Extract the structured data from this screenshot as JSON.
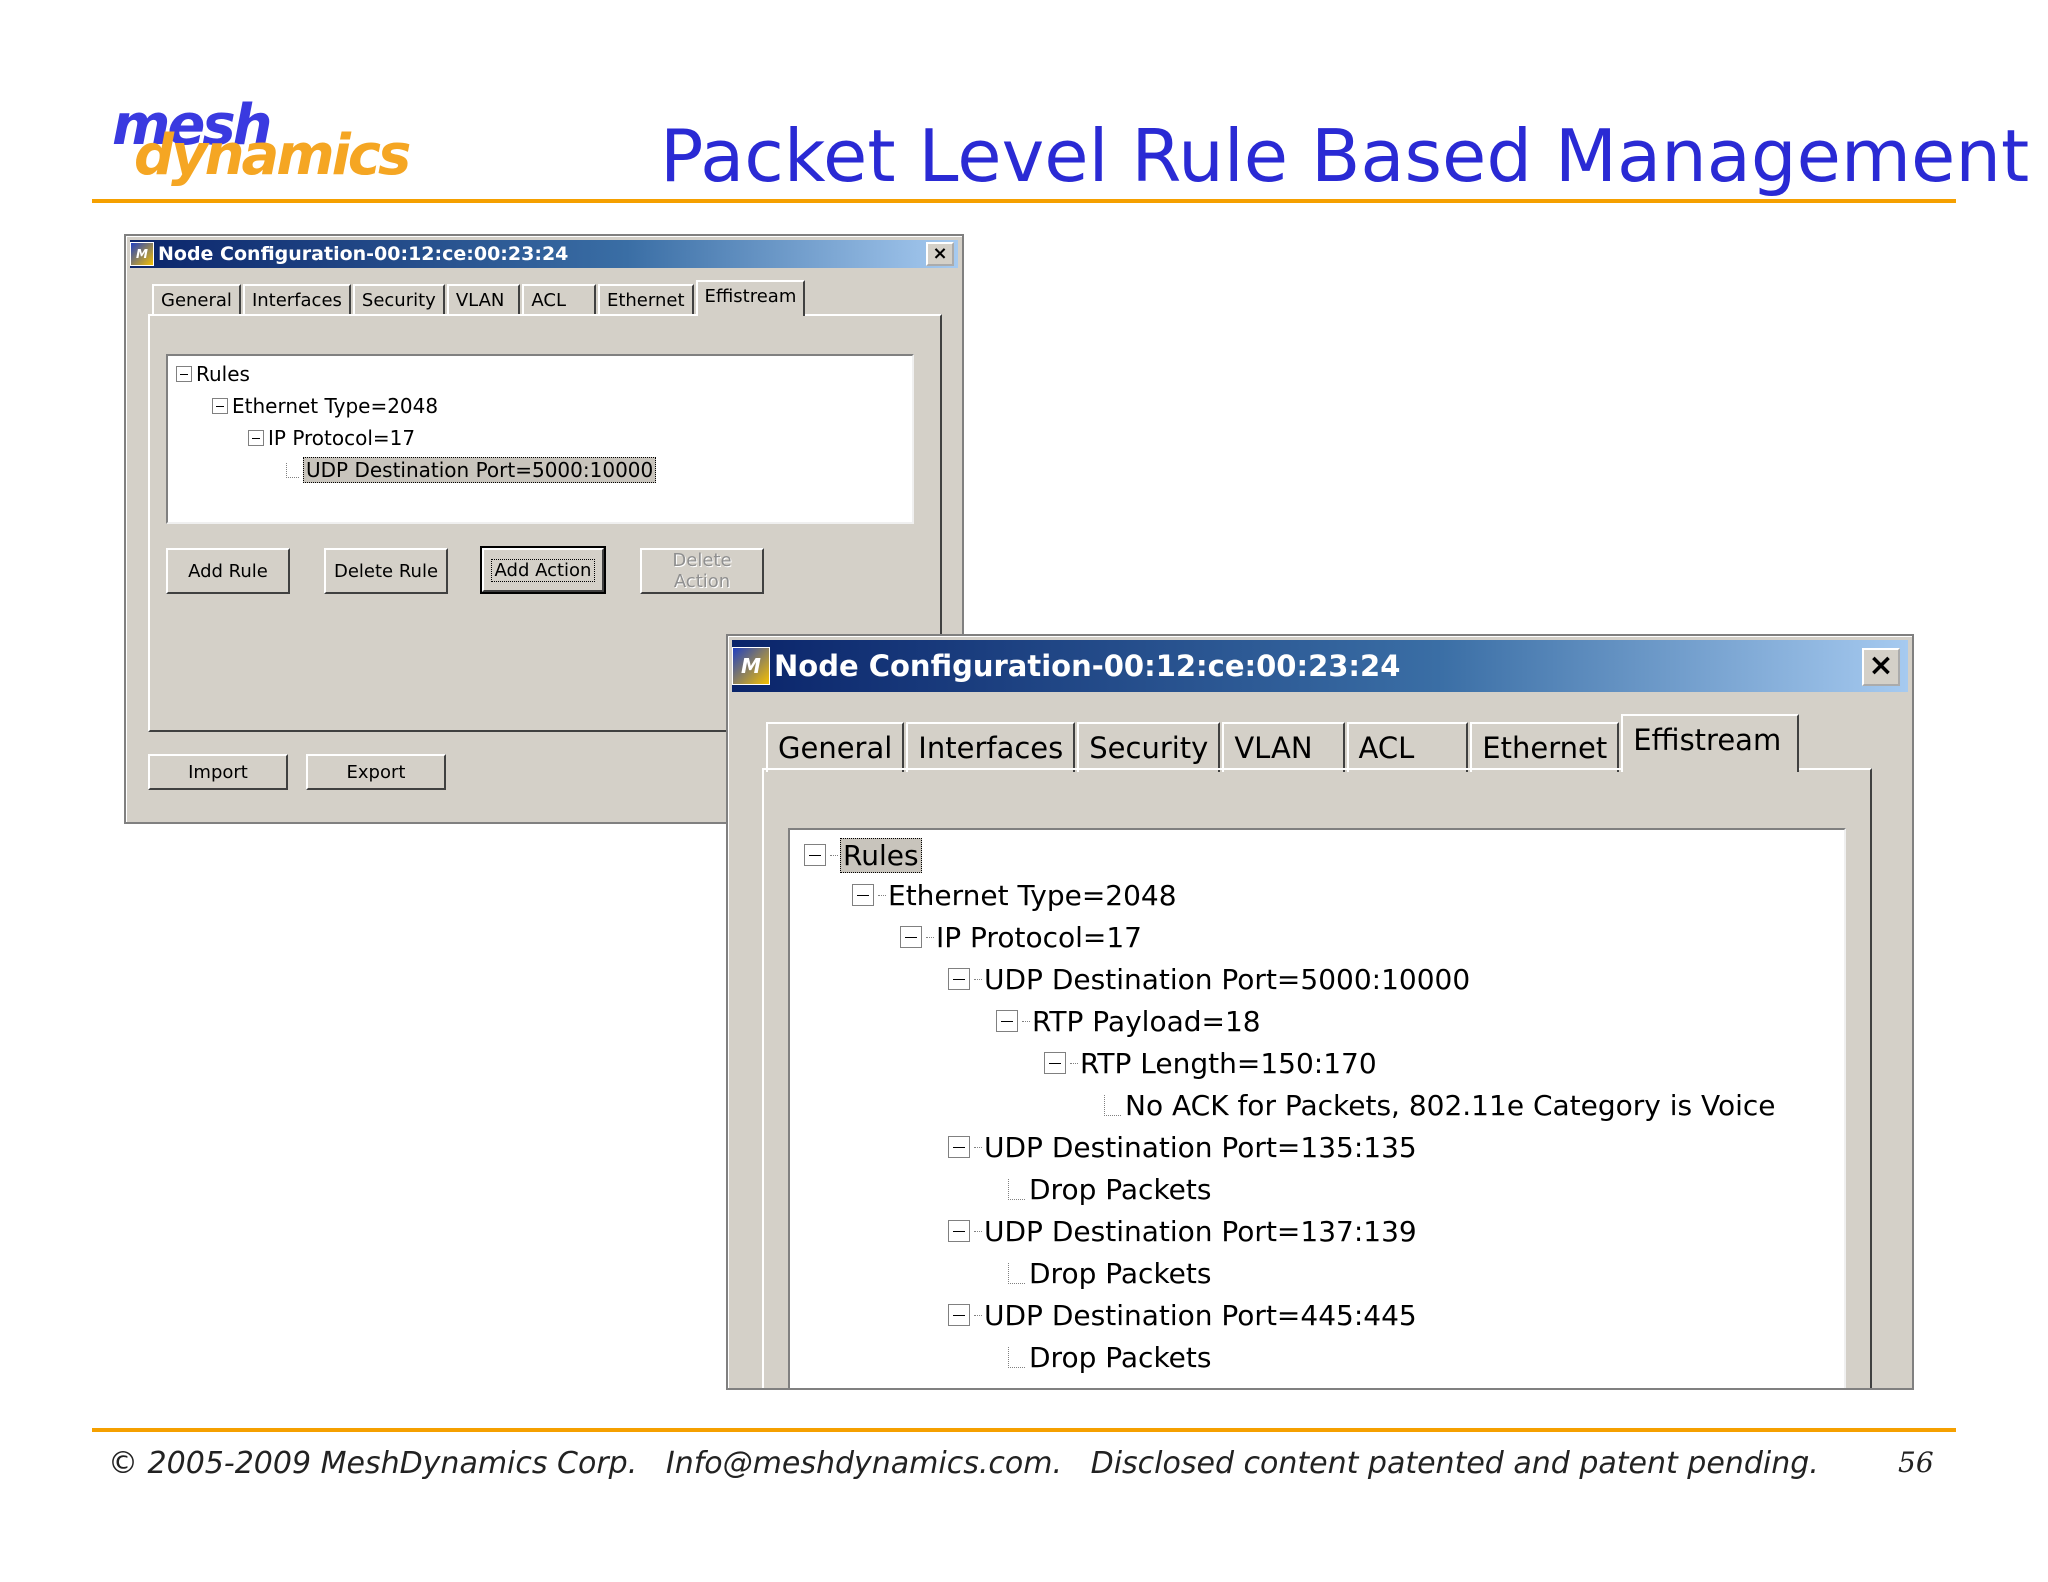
{
  "logo": {
    "part1": "mesh",
    "part2": "dynamics"
  },
  "title": "Packet Level Rule Based Management",
  "back_window": {
    "title": "Node Configuration-00:12:ce:00:23:24",
    "close_glyph": "×",
    "icon_text": "M",
    "tabs": [
      "General",
      "Interfaces",
      "Security",
      "VLAN",
      "ACL",
      "Ethernet",
      "Effistream"
    ],
    "active_tab": "Effistream",
    "tree": [
      "Rules",
      "Ethernet Type=2048",
      "IP Protocol=17",
      "UDP Destination Port=5000:10000"
    ],
    "buttons": {
      "add_rule": "Add Rule",
      "delete_rule": "Delete Rule",
      "add_action": "Add Action",
      "delete_action": "Delete Action"
    },
    "footer_buttons": {
      "import": "Import",
      "export": "Export"
    }
  },
  "front_window": {
    "title": "Node Configuration-00:12:ce:00:23:24",
    "close_glyph": "×",
    "icon_text": "M",
    "tabs": [
      "General",
      "Interfaces",
      "Security",
      "VLAN",
      "ACL",
      "Ethernet",
      "Effistream"
    ],
    "active_tab": "Effistream",
    "tree": [
      "Rules",
      "Ethernet Type=2048",
      "IP Protocol=17",
      "UDP Destination Port=5000:10000",
      "RTP Payload=18",
      "RTP Length=150:170",
      "No ACK for Packets, 802.11e Category is Voice",
      "UDP Destination Port=135:135",
      "Drop Packets",
      "UDP Destination Port=137:139",
      "Drop Packets",
      "UDP Destination Port=445:445",
      "Drop Packets"
    ]
  },
  "footer": "© 2005-2009 MeshDynamics Corp.   Info@meshdynamics.com.   Disclosed content patented and patent pending.",
  "page_number": "56",
  "colors": {
    "accent_rule": "#f5a000",
    "title_blue": "#2a2ad4",
    "titlebar_dark": "#0a246a",
    "window_face": "#d4d0c8"
  }
}
